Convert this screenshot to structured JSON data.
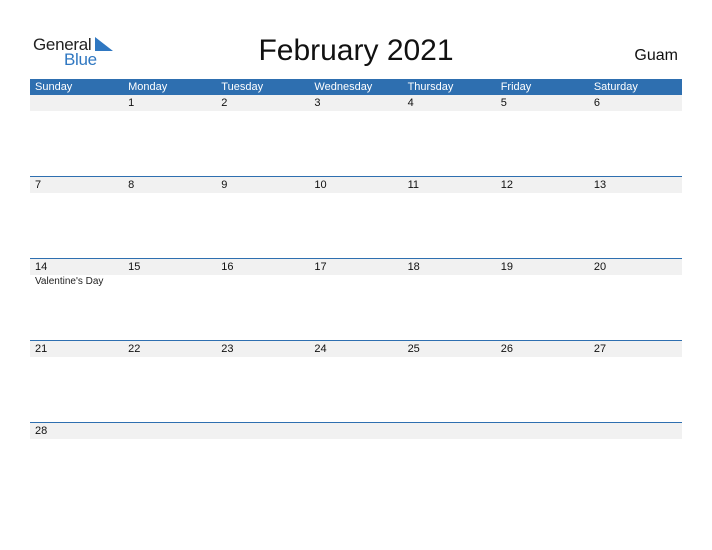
{
  "logo": {
    "line1": "General",
    "line2": "Blue",
    "accent": "#2f77c1"
  },
  "title": "February 2021",
  "country": "Guam",
  "colors": {
    "header_bg": "#2e6fb0",
    "day_row_bg": "#f1f1f1"
  },
  "weekdays": [
    "Sunday",
    "Monday",
    "Tuesday",
    "Wednesday",
    "Thursday",
    "Friday",
    "Saturday"
  ],
  "weeks": [
    {
      "days": [
        "",
        "1",
        "2",
        "3",
        "4",
        "5",
        "6"
      ],
      "events": [
        "",
        "",
        "",
        "",
        "",
        "",
        ""
      ]
    },
    {
      "days": [
        "7",
        "8",
        "9",
        "10",
        "11",
        "12",
        "13"
      ],
      "events": [
        "",
        "",
        "",
        "",
        "",
        "",
        ""
      ]
    },
    {
      "days": [
        "14",
        "15",
        "16",
        "17",
        "18",
        "19",
        "20"
      ],
      "events": [
        "Valentine's Day",
        "",
        "",
        "",
        "",
        "",
        ""
      ]
    },
    {
      "days": [
        "21",
        "22",
        "23",
        "24",
        "25",
        "26",
        "27"
      ],
      "events": [
        "",
        "",
        "",
        "",
        "",
        "",
        ""
      ]
    },
    {
      "days": [
        "28",
        "",
        "",
        "",
        "",
        "",
        ""
      ],
      "events": [
        "",
        "",
        "",
        "",
        "",
        "",
        ""
      ]
    }
  ]
}
